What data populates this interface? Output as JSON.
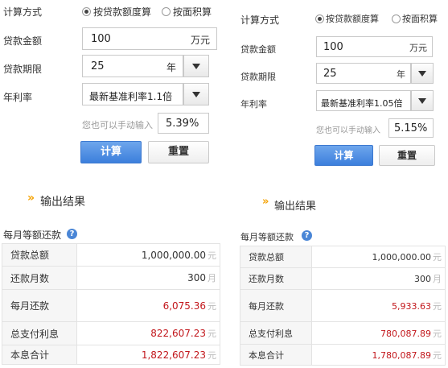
{
  "colors": {
    "accent_blue": "#4a86d6",
    "result_red": "#c2161b",
    "arrow_orange": "#f5a200"
  },
  "left": {
    "calc_method_label": "计算方式",
    "radio_by_amount": "按贷款额度算",
    "radio_by_area": "按面积算",
    "amount_label": "贷款金额",
    "amount_value": "100",
    "amount_unit": "万元",
    "term_label": "贷款期限",
    "term_value": "25",
    "term_unit": "年",
    "rate_label": "年利率",
    "rate_select": "最新基准利率1.1倍",
    "manual_hint": "您也可以手动输入",
    "rate_value": "5.39%",
    "calc_button": "计算",
    "reset_button": "重置",
    "result_title": "输出结果",
    "section_title": "每月等额还款",
    "rows": [
      {
        "label": "贷款总额",
        "value": "1,000,000.00",
        "unit": "元"
      },
      {
        "label": "还款月数",
        "value": "300",
        "unit": "月"
      },
      {
        "label": "每月还款",
        "value": "6,075.36",
        "unit": "元"
      },
      {
        "label": "总支付利息",
        "value": "822,607.23",
        "unit": "元"
      },
      {
        "label": "本息合计",
        "value": "1,822,607.23",
        "unit": "元"
      }
    ]
  },
  "right": {
    "calc_method_label": "计算方式",
    "radio_by_amount": "按贷款额度算",
    "radio_by_area": "按面积算",
    "amount_label": "贷款金额",
    "amount_value": "100",
    "amount_unit": "万元",
    "term_label": "贷款期限",
    "term_value": "25",
    "term_unit": "年",
    "rate_label": "年利率",
    "rate_select": "最新基准利率1.05倍",
    "manual_hint": "您也可以手动输入",
    "rate_value": "5.15%",
    "calc_button": "计算",
    "reset_button": "重置",
    "result_title": "输出结果",
    "section_title": "每月等额还款",
    "rows": [
      {
        "label": "贷款总额",
        "value": "1,000,000.00",
        "unit": "元"
      },
      {
        "label": "还款月数",
        "value": "300",
        "unit": "月"
      },
      {
        "label": "每月还款",
        "value": "5,933.63",
        "unit": "元"
      },
      {
        "label": "总支付利息",
        "value": "780,087.89",
        "unit": "元"
      },
      {
        "label": "本息合计",
        "value": "1,780,087.89",
        "unit": "元"
      }
    ]
  }
}
